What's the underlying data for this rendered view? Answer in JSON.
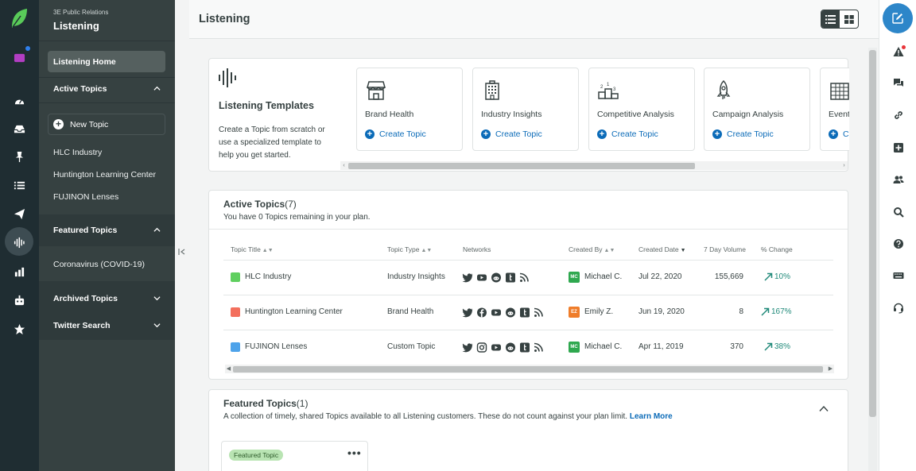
{
  "sidebar": {
    "org": "3E Public Relations",
    "app": "Listening",
    "home": "Listening Home",
    "active_topics": "Active Topics",
    "new_topic": "New Topic",
    "active_items": [
      "HLC Industry",
      "Huntington Learning Center",
      "FUJINON Lenses"
    ],
    "featured_topics": "Featured Topics",
    "featured_items": [
      "Coronavirus (COVID-19)"
    ],
    "archived_topics": "Archived Topics",
    "twitter_search": "Twitter Search"
  },
  "header": {
    "title": "Listening"
  },
  "templates": {
    "title": "Listening Templates",
    "description": "Create a Topic from scratch or use a specialized template to help you get started.",
    "cards": [
      {
        "name": "Brand Health",
        "link": "Create Topic",
        "icon": "storefront-icon"
      },
      {
        "name": "Industry Insights",
        "link": "Create Topic",
        "icon": "building-icon"
      },
      {
        "name": "Competitive Analysis",
        "link": "Create Topic",
        "icon": "podium-icon"
      },
      {
        "name": "Campaign Analysis",
        "link": "Create Topic",
        "icon": "rocket-icon"
      },
      {
        "name": "Event",
        "link": "Create Topic",
        "icon": "calendar-icon"
      }
    ]
  },
  "active": {
    "title": "Active Topics",
    "count": "(7)",
    "subtitle": "You have 0 Topics remaining in your plan.",
    "columns": [
      "Topic Title",
      "Topic Type",
      "Networks",
      "Created By",
      "Created Date",
      "7 Day Volume",
      "% Change"
    ],
    "rows": [
      {
        "title": "HLC Industry",
        "color": "#5fcf5f",
        "type": "Industry Insights",
        "networks": [
          "twitter",
          "youtube",
          "reddit",
          "tumblr",
          "rss"
        ],
        "initials": "MC",
        "avatar_color": "#2fa84f",
        "creator": "Michael C.",
        "date": "Jul 22, 2020",
        "volume": "155,669",
        "change": "10%"
      },
      {
        "title": "Huntington Learning Center",
        "color": "#f36f5d",
        "type": "Brand Health",
        "networks": [
          "twitter",
          "facebook",
          "youtube",
          "reddit",
          "tumblr",
          "rss"
        ],
        "initials": "EZ",
        "avatar_color": "#ef7d2a",
        "creator": "Emily Z.",
        "date": "Jun 19, 2020",
        "volume": "8",
        "change": "167%"
      },
      {
        "title": "FUJINON Lenses",
        "color": "#4ea3ea",
        "type": "Custom Topic",
        "networks": [
          "twitter",
          "instagram",
          "youtube",
          "reddit",
          "tumblr",
          "rss"
        ],
        "initials": "MC",
        "avatar_color": "#2fa84f",
        "creator": "Michael C.",
        "date": "Apr 11, 2019",
        "volume": "370",
        "change": "38%"
      }
    ]
  },
  "featured": {
    "title": "Featured Topics",
    "count": "(1)",
    "subtitle": "A collection of timely, shared Topics available to all Listening customers. These do not count against your plan limit.",
    "learn_more": "Learn More",
    "badge": "Featured Topic",
    "more": "•••"
  },
  "colors": {
    "accent": "#2d86c9",
    "sidebar": "#364141",
    "rail": "#1f2d32",
    "link": "#0b6bb8",
    "positive": "#218a7a"
  }
}
